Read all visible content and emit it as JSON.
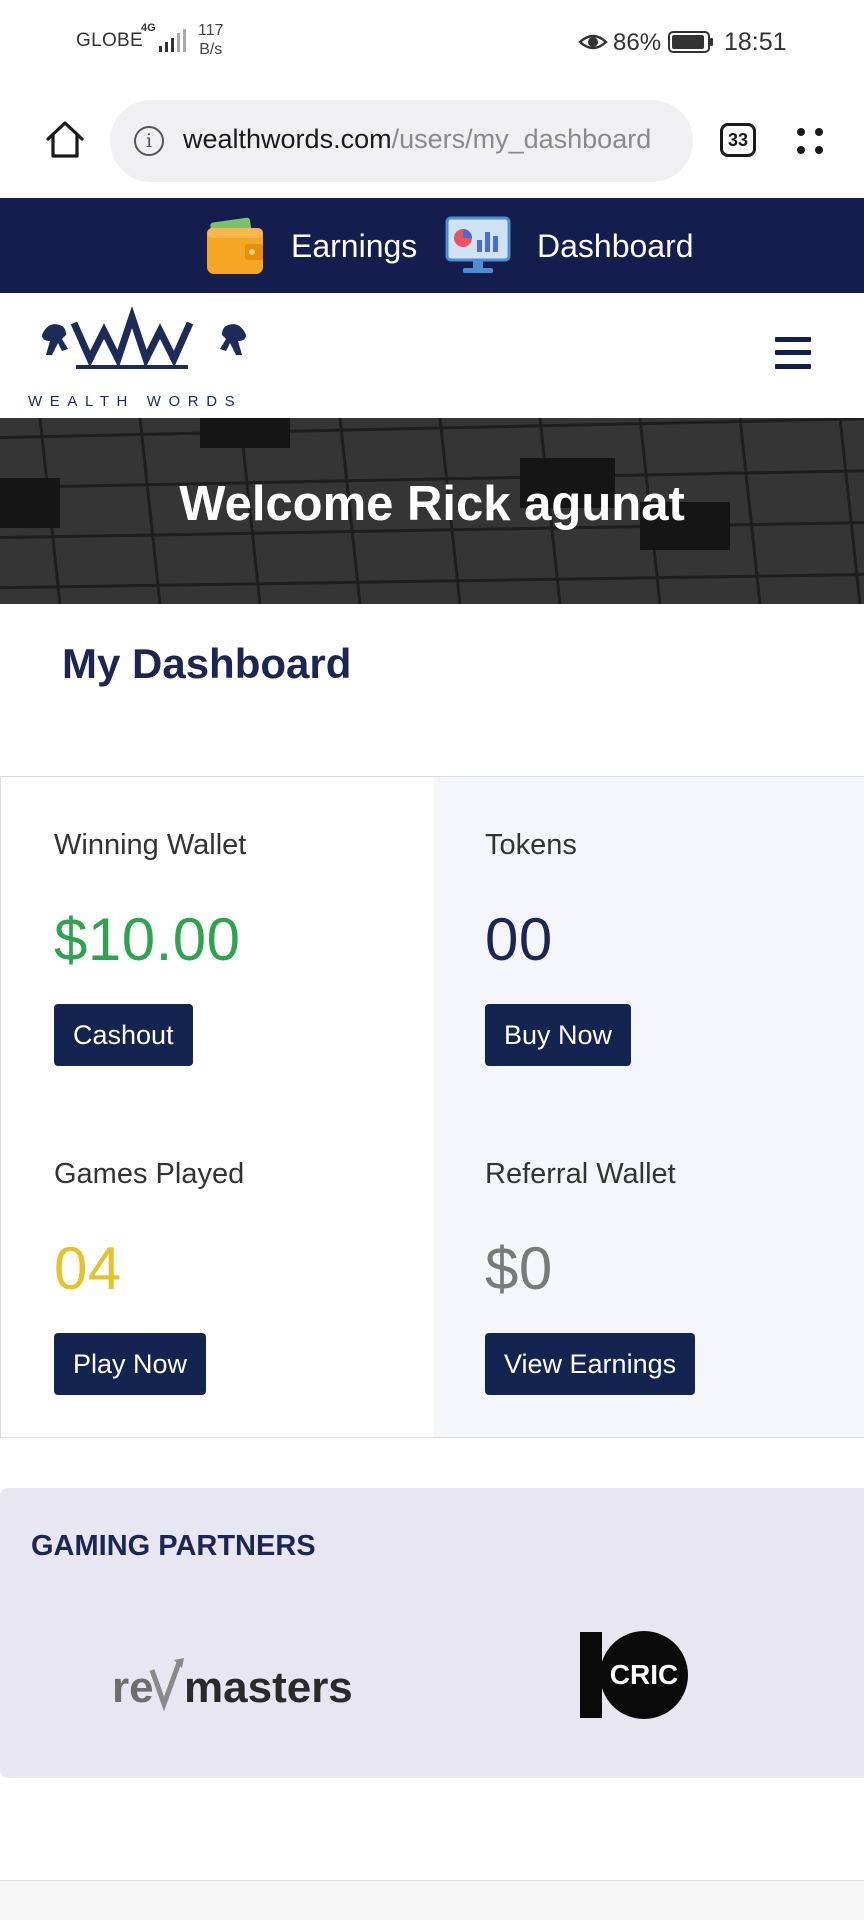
{
  "status_bar": {
    "carrier": "GLOBE",
    "network": "4G",
    "speed_value": "117",
    "speed_unit": "B/s",
    "battery": "86%",
    "time": "18:51"
  },
  "browser": {
    "url_domain": "wealthwords.com",
    "url_path": "/users/my_dashboard",
    "tab_count": "33"
  },
  "top_nav": {
    "earnings": "Earnings",
    "dashboard": "Dashboard"
  },
  "brand": {
    "name": "WEALTH WORDS",
    "monogram": "WW",
    "color": "#1c2b57"
  },
  "hero": {
    "title": "Welcome Rick agunat"
  },
  "dashboard": {
    "title": "My Dashboard",
    "winning_wallet": {
      "label": "Winning Wallet",
      "value": "$10.00",
      "button": "Cashout",
      "color": "#2ea44f"
    },
    "tokens": {
      "label": "Tokens",
      "value": "00",
      "button": "Buy Now",
      "color": "#1c2654"
    },
    "games_played": {
      "label": "Games Played",
      "value": "04",
      "button": "Play Now",
      "color": "#e6c229"
    },
    "referral_wallet": {
      "label": "Referral Wallet",
      "value": "$0",
      "button": "View Earnings",
      "color": "#7a7a7a"
    }
  },
  "partners": {
    "title": "GAMING PARTNERS",
    "items": [
      {
        "name_part1": "re",
        "name_part2": "masters"
      },
      {
        "name": "CRIC"
      }
    ]
  },
  "colors": {
    "navy": "#141e4e",
    "button": "#132451",
    "partners_bg": "#e8e7f1"
  }
}
